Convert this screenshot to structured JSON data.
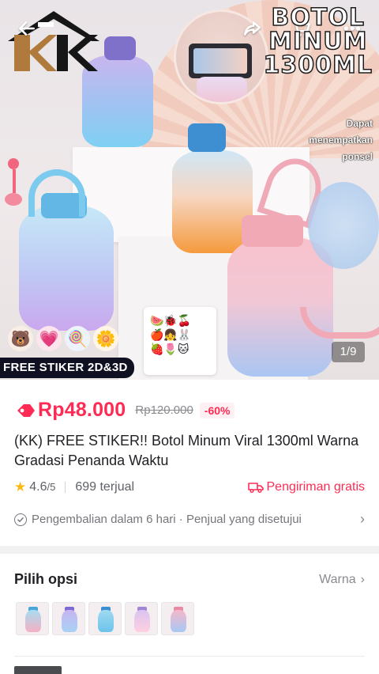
{
  "hero": {
    "promo_title_lines": [
      "BOTOL",
      "MINUM",
      "1300ML"
    ],
    "promo_sub_lines": [
      "Dapat",
      "menempatkan",
      "ponsel"
    ],
    "free_banner": "FREE STIKER 2D&3D",
    "image_counter": "1/9",
    "icons": [
      "back-arrow-icon",
      "share-icon",
      "cart-icon",
      "more-icon"
    ],
    "logo_text": "KK"
  },
  "product": {
    "price": "Rp48.000",
    "original_price": "Rp120.000",
    "discount": "-60%",
    "title": "(KK) FREE STIKER!! Botol Minum Viral 1300ml Warna Gradasi Penanda Waktu",
    "rating_value": "4.6",
    "rating_max": "/5",
    "sold": "699 terjual",
    "shipping": "Pengiriman gratis",
    "return_info": "Pengembalian dalam 6 hari · Penjual yang disetujui"
  },
  "options": {
    "title": "Pilih opsi",
    "selected_attribute": "Warna",
    "swatch_colors": [
      {
        "top": "#a6dcf0",
        "bottom": "#f6b0c4",
        "cap": "#4aa6d9"
      },
      {
        "top": "#c7b4ef",
        "bottom": "#a7d3f6",
        "cap": "#7e6bd4"
      },
      {
        "top": "#9fd9f2",
        "bottom": "#6cc4ea",
        "cap": "#3b8fd0"
      },
      {
        "top": "#d9c3f0",
        "bottom": "#ffd0e0",
        "cap": "#9f84d8"
      },
      {
        "top": "#f5b7c8",
        "bottom": "#a7c8f5",
        "cap": "#e88aa2"
      }
    ]
  },
  "colors": {
    "accent": "#fe2c55",
    "star": "#fdb813",
    "banner_bg": "#0f1022"
  }
}
